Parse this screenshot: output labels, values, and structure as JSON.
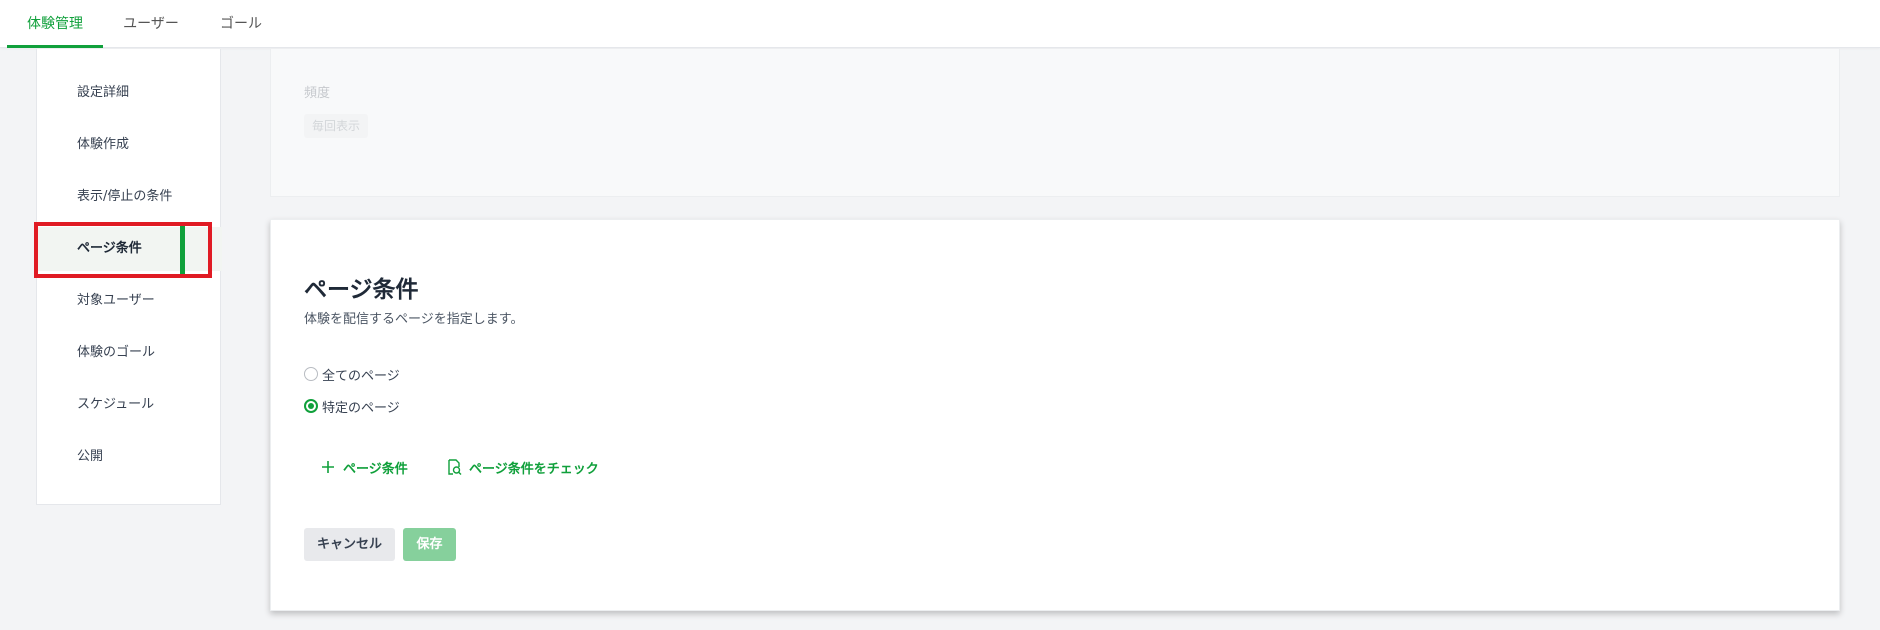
{
  "top_tabs": [
    {
      "label": "体験管理",
      "active": true
    },
    {
      "label": "ユーザー",
      "active": false
    },
    {
      "label": "ゴール",
      "active": false
    }
  ],
  "sidebar": {
    "items": [
      {
        "label": "設定詳細"
      },
      {
        "label": "体験作成"
      },
      {
        "label": "表示/停止の条件"
      },
      {
        "label": "ページ条件",
        "active": true
      },
      {
        "label": "対象ユーザー"
      },
      {
        "label": "体験のゴール"
      },
      {
        "label": "スケジュール"
      },
      {
        "label": "公開"
      }
    ]
  },
  "frequency_section": {
    "label": "頻度",
    "value": "毎回表示"
  },
  "page_condition": {
    "title": "ページ条件",
    "description": "体験を配信するページを指定します。",
    "options": [
      {
        "label": "全てのページ",
        "checked": false
      },
      {
        "label": "特定のページ",
        "checked": true
      }
    ],
    "add_condition_label": "ページ条件",
    "check_condition_label": "ページ条件をチェック",
    "cancel_label": "キャンセル",
    "save_label": "保存"
  },
  "colors": {
    "accent": "#10a03b",
    "highlight": "#e01b24",
    "save_disabled": "#86d09c"
  },
  "icons": {
    "add": "plus-icon",
    "check": "document-search-icon"
  }
}
